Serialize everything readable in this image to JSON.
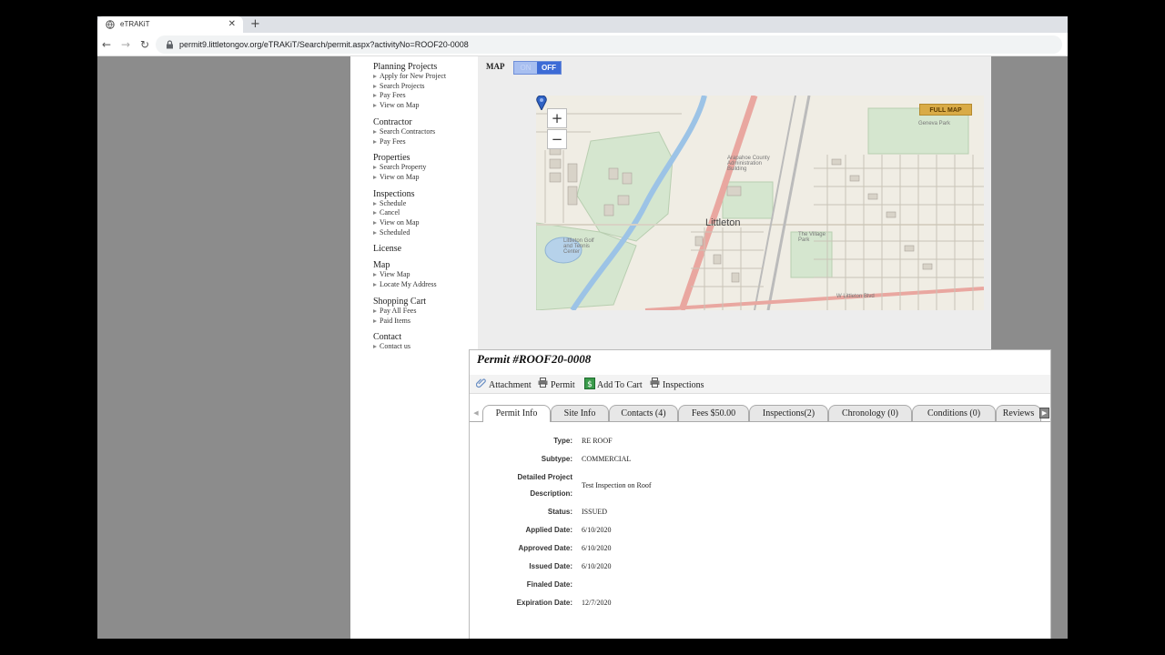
{
  "browser": {
    "tab_title": "eTRAKiT",
    "tab_close": "✕",
    "new_tab": "+",
    "url": "permit9.littletongov.org/eTRAKiT/Search/permit.aspx?activityNo=ROOF20-0008",
    "back": "←",
    "forward": "→",
    "reload": "↻"
  },
  "sidebar": {
    "sections": [
      {
        "title": "Planning Projects",
        "links": [
          "Apply for New Project",
          "Search Projects",
          "Pay Fees",
          "View on Map"
        ]
      },
      {
        "title": "Contractor",
        "links": [
          "Search Contractors",
          "Pay Fees"
        ]
      },
      {
        "title": "Properties",
        "links": [
          "Search Property",
          "View on Map"
        ]
      },
      {
        "title": "Inspections",
        "links": [
          "Schedule",
          "Cancel",
          "View on Map",
          "Scheduled"
        ]
      },
      {
        "title": "License",
        "links": []
      },
      {
        "title": "Map",
        "links": [
          "View Map",
          "Locate My Address"
        ]
      },
      {
        "title": "Shopping Cart",
        "links": [
          "Pay All Fees",
          "Paid Items"
        ]
      },
      {
        "title": "Contact",
        "links": [
          "Contact us"
        ]
      }
    ]
  },
  "map": {
    "label": "MAP",
    "toggle_on": "ON",
    "toggle_off": "OFF",
    "zoom_in": "+",
    "zoom_out": "−",
    "full_map": "FULL MAP",
    "town": "Littleton",
    "places": [
      "Arapahoe County Administration Building",
      "Littleton Golf and Tennis Center",
      "The Village Park",
      "W Littleton Blvd",
      "Geneva Park"
    ]
  },
  "permit": {
    "title": "Permit #ROOF20-0008",
    "actions": [
      "Attachment",
      "Permit",
      "Add To Cart",
      "Inspections"
    ],
    "tabs": [
      "Permit Info",
      "Site Info",
      "Contacts (4)",
      "Fees $50.00",
      "Inspections(2)",
      "Chronology (0)",
      "Conditions (0)",
      "Reviews"
    ],
    "fields": [
      {
        "label": "Type:",
        "value": "RE ROOF"
      },
      {
        "label": "Subtype:",
        "value": "COMMERCIAL"
      },
      {
        "label": "Detailed Project",
        "label2": "Description:",
        "value": "Test Inspection on Roof"
      },
      {
        "label": "Status:",
        "value": "ISSUED"
      },
      {
        "label": "Applied Date:",
        "value": "6/10/2020"
      },
      {
        "label": "Approved Date:",
        "value": "6/10/2020"
      },
      {
        "label": "Issued Date:",
        "value": "6/10/2020"
      },
      {
        "label": "Finaled Date:",
        "value": ""
      },
      {
        "label": "Expiration Date:",
        "value": "12/7/2020"
      }
    ]
  },
  "colors": {
    "toggle_off": "#3d6bd6",
    "full_map_button": "#d9ab47",
    "page_gray": "#8c8c8c"
  }
}
